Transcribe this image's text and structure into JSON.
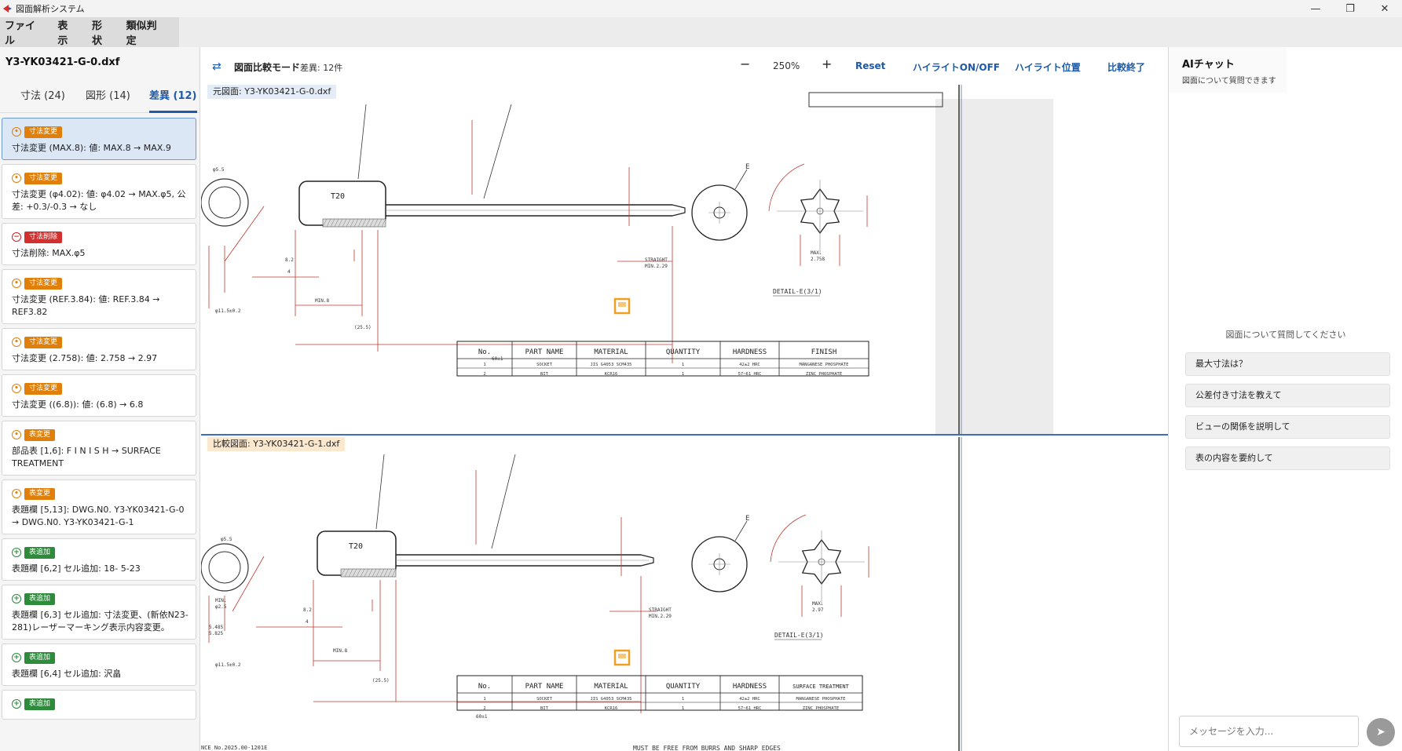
{
  "window": {
    "title": "図面解析システム",
    "controls": {
      "minimize": "—",
      "maximize": "❐",
      "close": "✕"
    }
  },
  "menu": [
    "ファイル",
    "表示",
    "形状",
    "類似判定"
  ],
  "left_panel": {
    "filename": "Y3-YK03421-G-0.dxf",
    "tabs": [
      {
        "label": "寸法 (24)",
        "active": false
      },
      {
        "label": "図形 (14)",
        "active": false
      },
      {
        "label": "差異 (12)",
        "active": true
      }
    ],
    "diffs": [
      {
        "kind": "mod",
        "badge": "寸法変更",
        "text": "寸法変更 (MAX.8): 値: MAX.8 → MAX.9",
        "selected": true
      },
      {
        "kind": "mod",
        "badge": "寸法変更",
        "text": "寸法変更 (φ4.02): 値: φ4.02 → MAX.φ5, 公差: +0.3/-0.3 → なし",
        "selected": false
      },
      {
        "kind": "del",
        "badge": "寸法削除",
        "text": "寸法削除: MAX.φ5",
        "selected": false
      },
      {
        "kind": "mod",
        "badge": "寸法変更",
        "text": "寸法変更 (REF.3.84): 値: REF.3.84 → REF3.82",
        "selected": false
      },
      {
        "kind": "mod",
        "badge": "寸法変更",
        "text": "寸法変更 (2.758): 値: 2.758 → 2.97",
        "selected": false
      },
      {
        "kind": "mod",
        "badge": "寸法変更",
        "text": "寸法変更 ((6.8)): 値: (6.8) → 6.8",
        "selected": false
      },
      {
        "kind": "mod",
        "badge": "表変更",
        "text": "部品表 [1,6]: F I N I S H → SURFACE TREATMENT",
        "selected": false
      },
      {
        "kind": "mod",
        "badge": "表変更",
        "text": "表題欄 [5,13]: DWG.N0. Y3-YK03421-G-0 → DWG.N0. Y3-YK03421-G-1",
        "selected": false
      },
      {
        "kind": "add",
        "badge": "表追加",
        "text": "表題欄 [6,2] セル追加: 18- 5-23",
        "selected": false
      },
      {
        "kind": "add",
        "badge": "表追加",
        "text": "表題欄 [6,3] セル追加: 寸法変更、(新依N23-281)レーザーマーキング表示内容変更。",
        "selected": false
      },
      {
        "kind": "add",
        "badge": "表追加",
        "text": "表題欄 [6,4] セル追加: 沢畠",
        "selected": false
      },
      {
        "kind": "add",
        "badge": "表追加",
        "text": "",
        "selected": false
      }
    ]
  },
  "toolbar": {
    "mode_title": "図面比較モード",
    "diff_count": "差異: 12件",
    "zoom_out": "−",
    "zoom": "250%",
    "zoom_in": "+",
    "reset": "Reset",
    "highlight_toggle": "ハイライトON/OFF",
    "highlight_position": "ハイライト位置",
    "end_compare": "比較終了"
  },
  "panes": {
    "original_label": "元図面: Y3-YK03421-G-0.dxf",
    "compare_label": "比較図面: Y3-YK03421-G-1.dxf"
  },
  "drawing": {
    "detail_label": "DETAIL-E(3/1)",
    "view_letter": "E",
    "straight_label": "STRAIGHT",
    "straight_top": "MIN.2.29",
    "straight_bottom": "MIN.2.29",
    "max_top": "MAX.",
    "max_val_top": "2.758",
    "max_bottom": "MAX.",
    "max_val_bottom": "2.97",
    "dim_total": "60±1",
    "dim_mid": "(25.5)",
    "dim_small": "MIN.8",
    "dim_phi": "φ5.5",
    "dim_side": "φ11.5±0.2",
    "dim_minphi": "MIN.",
    "dim_minphi_val": "φ2.5",
    "dim_88": "8.2",
    "dim_4": "4",
    "dim_485": "5.485",
    "dim_825": "5.825",
    "mark_text": "T20",
    "table_headers": [
      "No.",
      "PART NAME",
      "MATERIAL",
      "QUANTITY",
      "HARDNESS",
      "FINISH"
    ],
    "table_headers_bottom": [
      "No.",
      "PART NAME",
      "MATERIAL",
      "QUANTITY",
      "HARDNESS",
      "SURFACE TREATMENT"
    ],
    "table_rows": [
      [
        "1",
        "SOCKET",
        "JIS G4053 SCM435",
        "1",
        "42±2  HRC",
        "MANGANESE PHOSPHATE"
      ],
      [
        "2",
        "BIT",
        "KCR16",
        "1",
        "57~61  HRC",
        "ZINC PHOSPHATE"
      ]
    ],
    "footer_left": "NCE No.2025.00-1201E",
    "footer_center": "MUST BE FREE FROM BURRS AND SHARP EDGES"
  },
  "ai_panel": {
    "title": "AIチャット",
    "subtitle": "図面について質問できます",
    "empty": "図面について質問してください",
    "suggestions": [
      "最大寸法は？",
      "公差付き寸法を教えて",
      "ビューの関係を説明して",
      "表の内容を要約して"
    ],
    "input_placeholder": "メッセージを入力...",
    "send": "➤"
  },
  "colors": {
    "accent": "#1e5aa8",
    "modified": "#e0800b",
    "deleted": "#d32f2f",
    "added": "#2e8b3c",
    "dim_red": "#c0392b",
    "highlight": "#f0a020"
  }
}
